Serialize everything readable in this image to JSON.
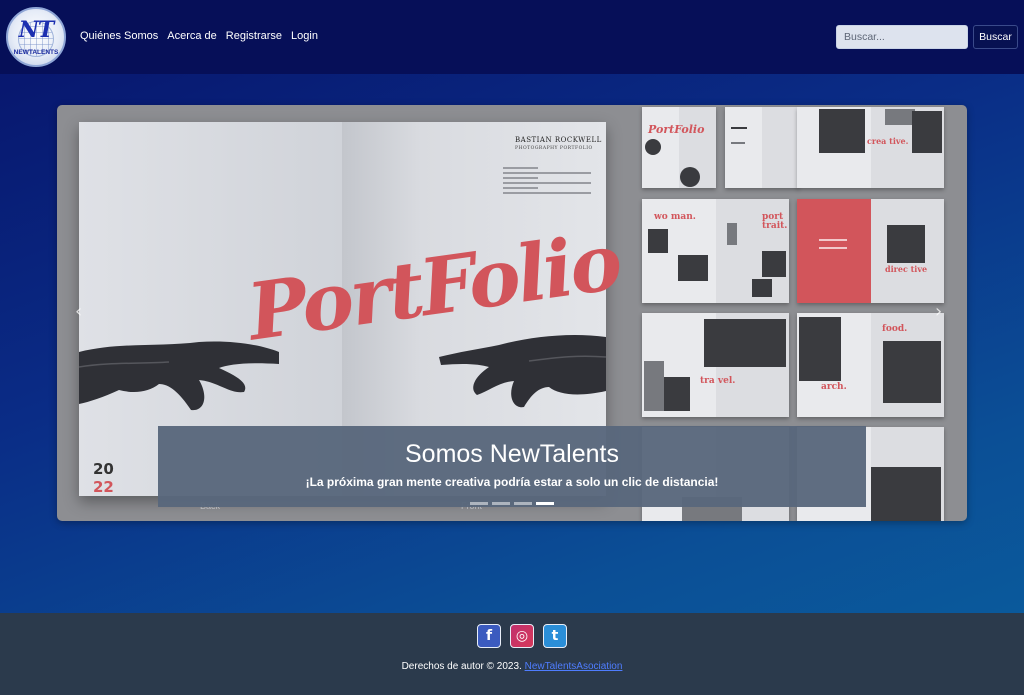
{
  "logo": {
    "monogram": "NT",
    "wordmark": "NEWTALENTS"
  },
  "nav": {
    "links": [
      "Quiénes Somos",
      "Acerca de",
      "Registrarse",
      "Login"
    ]
  },
  "search": {
    "placeholder": "Buscar...",
    "button_label": "Buscar"
  },
  "carousel": {
    "slide": {
      "author": "BASTIAN ROCKWELL",
      "subtitle": "PHOTOGRAPHY PORTFOLIO",
      "art_word": "PortFolio",
      "page_num_top": "20",
      "page_num_bottom": "22",
      "back_label": "Back",
      "front_label": "Front"
    },
    "thumb_words": [
      "PortFolio",
      "crea tive.",
      "wo man.",
      "port trait.",
      "direc tive",
      "tra vel.",
      "food.",
      "arch."
    ],
    "caption_title": "Somos NewTalents",
    "caption_text": "¡La próxima gran mente creativa podría estar a solo un clic de distancia!",
    "prev_icon": "‹",
    "next_icon": "›",
    "indicators": 4,
    "active_indicator": 4
  },
  "footer": {
    "socials": [
      {
        "name": "facebook-icon",
        "glyph": "f"
      },
      {
        "name": "instagram-icon",
        "glyph": "◎"
      },
      {
        "name": "twitter-icon",
        "glyph": "t"
      }
    ],
    "copyright_text": "Derechos de autor © 2023.",
    "copyright_link": "NewTalentsAsociation"
  },
  "colors": {
    "navbar": "#060f58",
    "accent_red": "#d2555b",
    "footer": "#2b3a4c",
    "link": "#4f7dff"
  }
}
